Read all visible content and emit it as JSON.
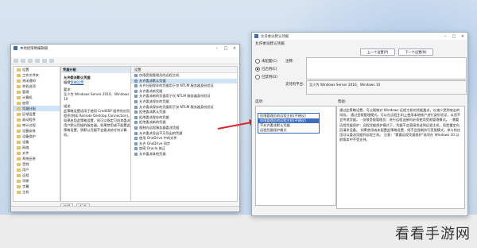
{
  "gpedit": {
    "title": "本地组策略编辑器",
    "tree": [
      "设置",
      "工作文件夹",
      "关闭通知",
      "关机选项",
      "管理",
      "计算机",
      "加密",
      "凭据分配",
      "区域设置",
      "驱动程序",
      "审计过程",
      "设备安装",
      "设备保护",
      "设备",
      "网络",
      "文件",
      "系统还原",
      "音频",
      "用户",
      "远程",
      "早期",
      "字幕",
      "主机"
    ],
    "selected_folder": "故障排除和诊断",
    "detail_header": "凭据分配",
    "detail_heading": "允许委派默认凭据",
    "detail_edit_prefix": "编辑",
    "detail_edit_link": "策略设置",
    "detail_req_label": "要求:",
    "detail_req_text": "至少为 Windows Server 2016、Windows 10",
    "detail_desc_label": "描述:",
    "detail_desc": "此策略设置适用于使用 CredSSP 组件的应用程序(例如 Remote Desktop Connection)。如果启用此策略设置，则可以指定可向其委派用户默认凭据的服务器。如果禁用或不配置此策略设置，则默认凭据不会委派给任何计算机。",
    "list_header": "设置",
    "list_rows": [
      "仅限受限管理员的远程主机",
      "允许委派默认凭据",
      "允许分配保存的凭据用于仅 NTLM 服务器身份验证",
      "允许委派新凭据",
      "允许委派新的凭据用于仅 NTLM 服务器身份验证",
      "允许委派保存的凭据",
      "允许委派保存的凭据用于仅 NTLM 服务器身份验证",
      "拒绝委派默认凭据",
      "拒绝委派保存的凭据",
      "拒绝委派新的凭据",
      "限制向远程服务器委派凭据",
      "允许委派导出不可导出的凭据",
      "使用 OneDrive 中的文件",
      "允许 OneDrive 同步",
      "加密 Oracle 修正",
      "允许委派其他凭据"
    ],
    "highlighted_row": 1,
    "tabs": [
      "扩展",
      "标准"
    ]
  },
  "dialog": {
    "title": "允许委派默认凭据",
    "heading": "允许委派默认凭据",
    "prev_button": "上一个设置(P)",
    "next_button": "下一个设置(N)",
    "radios": [
      "未配置(C)",
      "已启用(E)",
      "已禁用(D)"
    ],
    "selected_radio": 1,
    "comment_label": "注释:",
    "supported_label": "支持的平台:",
    "supported_text": "至少为 Windows Server 2016、Windows 10",
    "options_label": "选项:",
    "help_label": "帮助:",
    "dropdown_options": [
      "仅限管理员的远程主机(不建议)",
      "仅限管理员的远程主机(不建议)",
      "不允许委派默认凭据",
      "远程凭据保护模式"
    ],
    "dropdown_selected": 1,
    "help_text": "通过此策略设置，可以限制对 Windows 远程主机的凭据委派，以减少受到攻击的风险。 通过受限管理模式，可以在远程主机上使用本地帐户进行身份验证，从而不会传递凭据。 · 仅限受限管理员：进行远程连接时必须使用受限管理模式。 · 需要远程凭据保护：远程凭据保护模式下，凭据不会直接发送到远程主机，而是重定向回请求设备。 如果禁用或未配置此策略设置，则不会强制执行受限模式，参与的应用可以委派凭据到远程主机。 注意：\"需要远程凭据保护\"选项在 Windows 10 以前版本中不受支持。"
  },
  "watermark": "看看手游网"
}
